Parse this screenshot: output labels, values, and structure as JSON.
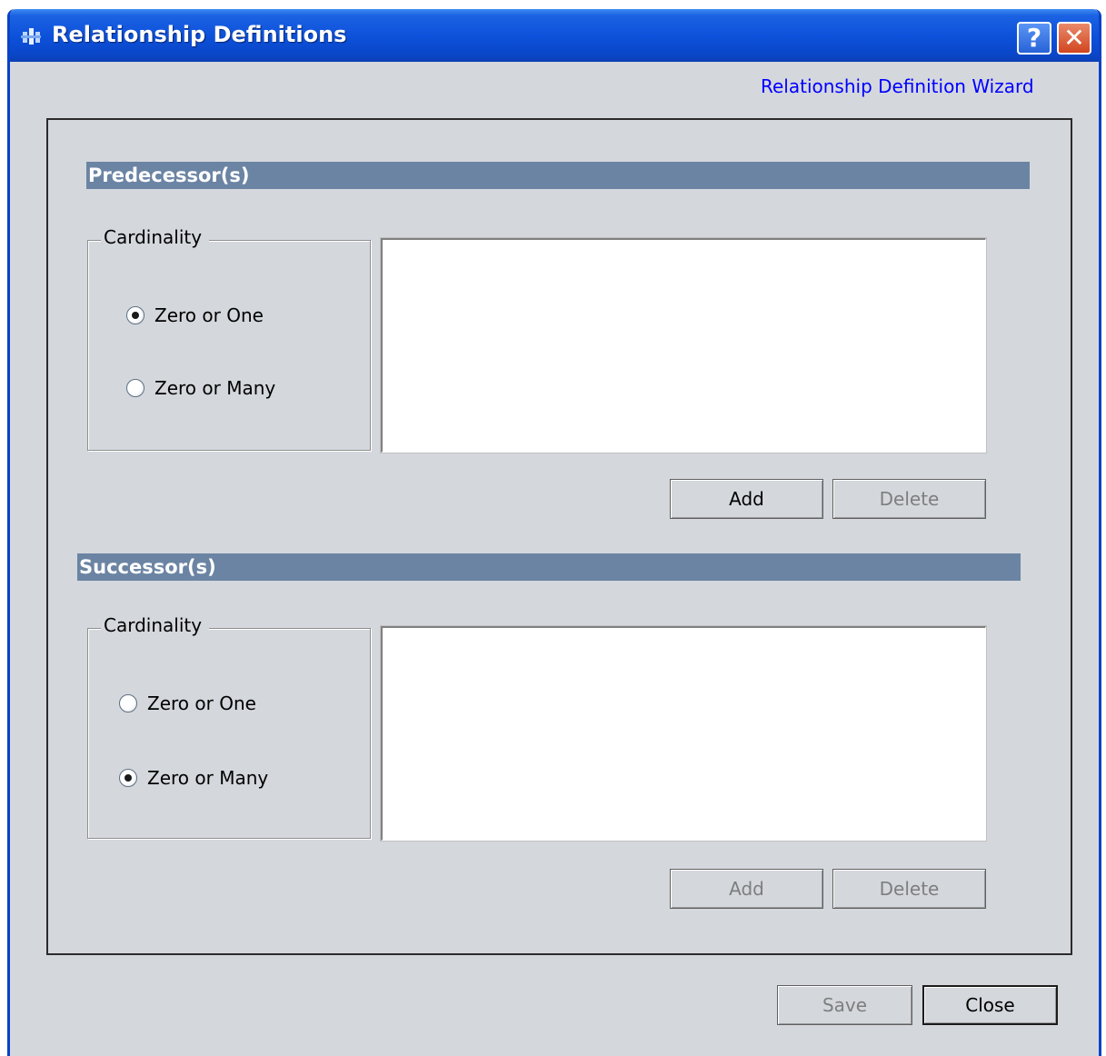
{
  "window": {
    "title": "Relationship Definitions",
    "help_label": "?",
    "close_label": "✕"
  },
  "wizard_link": "Relationship Definition Wizard",
  "predecessor": {
    "header": "Predecessor(s)",
    "cardinality_label": "Cardinality",
    "options": [
      {
        "label": "Zero or One",
        "checked": true
      },
      {
        "label": "Zero or Many",
        "checked": false
      }
    ],
    "add_label": "Add",
    "delete_label": "Delete",
    "add_enabled": true,
    "delete_enabled": false
  },
  "successor": {
    "header": "Successor(s)",
    "cardinality_label": "Cardinality",
    "options": [
      {
        "label": "Zero or One",
        "checked": false
      },
      {
        "label": "Zero or Many",
        "checked": true
      }
    ],
    "add_label": "Add",
    "delete_label": "Delete",
    "add_enabled": false,
    "delete_enabled": false
  },
  "footer": {
    "save_label": "Save",
    "close_label": "Close"
  },
  "colors": {
    "section_bar": "#6b84a3",
    "titlebar": "#0c50d9",
    "link": "#0000ff"
  }
}
